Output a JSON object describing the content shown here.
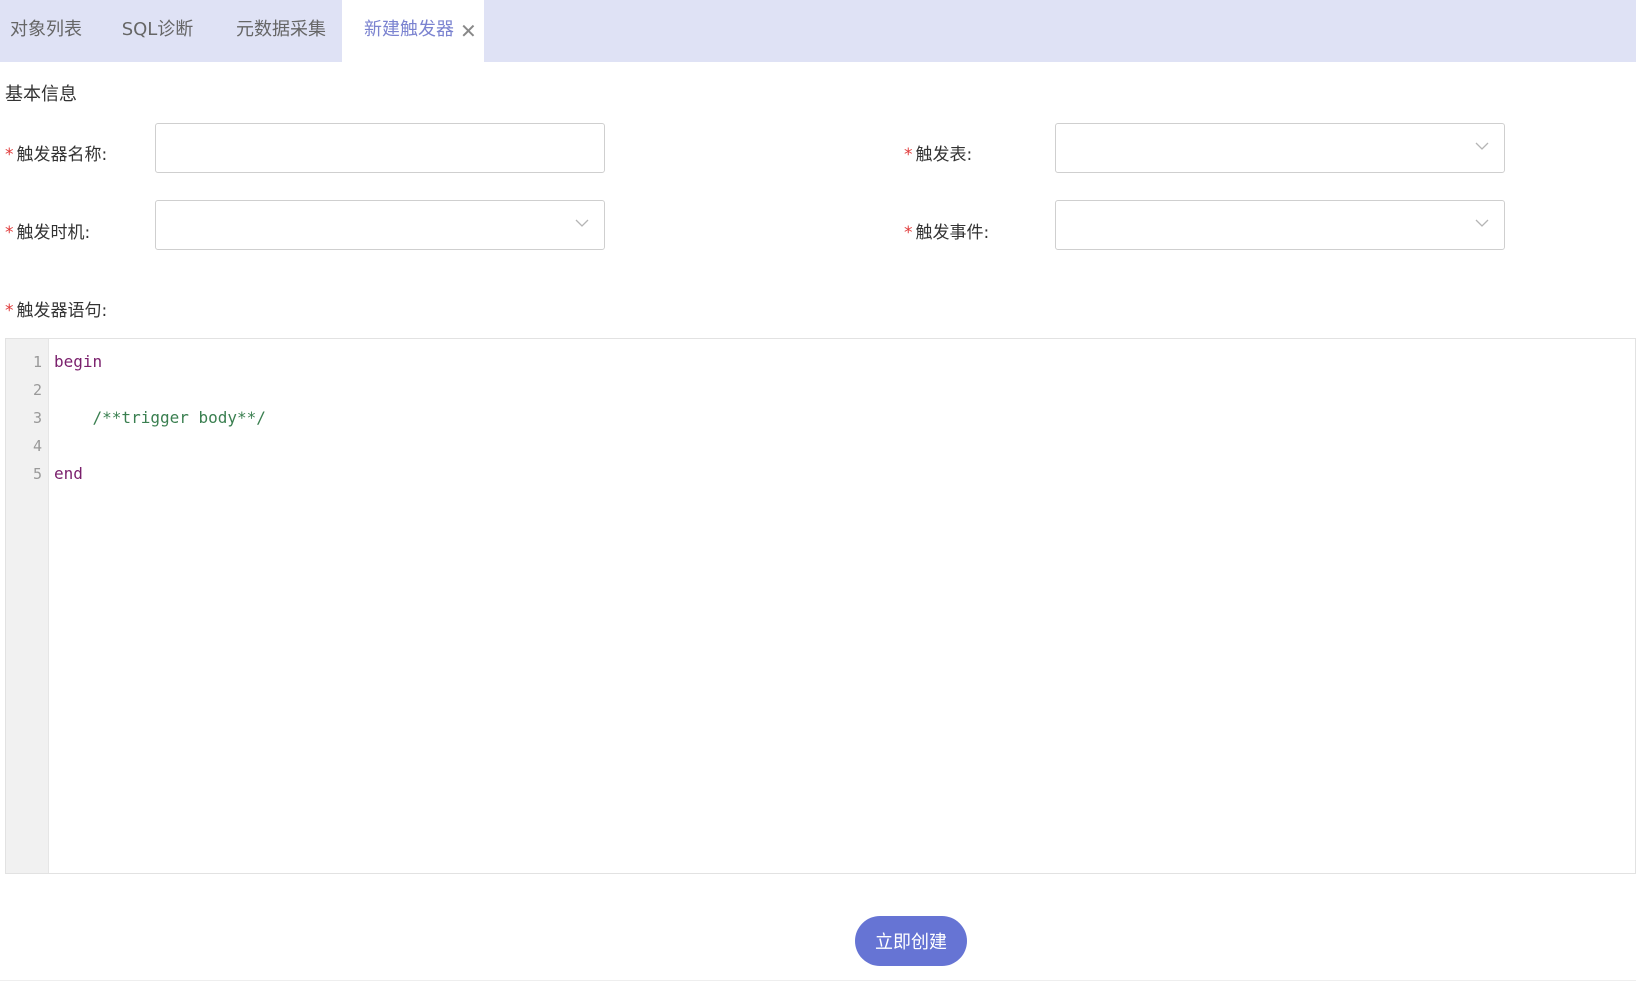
{
  "tabs": [
    {
      "label": "对象列表",
      "active": false
    },
    {
      "label": "SQL诊断",
      "active": false
    },
    {
      "label": "元数据采集",
      "active": false
    },
    {
      "label": "新建触发器",
      "active": true,
      "closable": true,
      "close_glyph": "✕"
    }
  ],
  "section_title": "基本信息",
  "required_mark": "*",
  "fields": {
    "trigger_name": {
      "label": "触发器名称:",
      "value": "",
      "placeholder": ""
    },
    "trigger_table": {
      "label": "触发表:",
      "value": ""
    },
    "trigger_timing": {
      "label": "触发时机:",
      "value": ""
    },
    "trigger_event": {
      "label": "触发事件:",
      "value": ""
    },
    "trigger_statement": {
      "label": "触发器语句:"
    }
  },
  "editor": {
    "line_numbers": [
      "1",
      "2",
      "3",
      "4",
      "5"
    ],
    "lines": [
      {
        "text": "begin",
        "kind": "keyword"
      },
      {
        "text": "",
        "kind": "plain"
      },
      {
        "text": "    /**trigger body**/",
        "kind": "comment"
      },
      {
        "text": "",
        "kind": "plain"
      },
      {
        "text": "end",
        "kind": "keyword"
      }
    ]
  },
  "submit_label": "立即创建",
  "colors": {
    "accent": "#6674d4",
    "tab_bar": "#dfe2f5",
    "active_tab_text": "#7b83d0",
    "required": "#e03b3b",
    "keyword": "#7a1f6c",
    "comment": "#3a7f50"
  }
}
